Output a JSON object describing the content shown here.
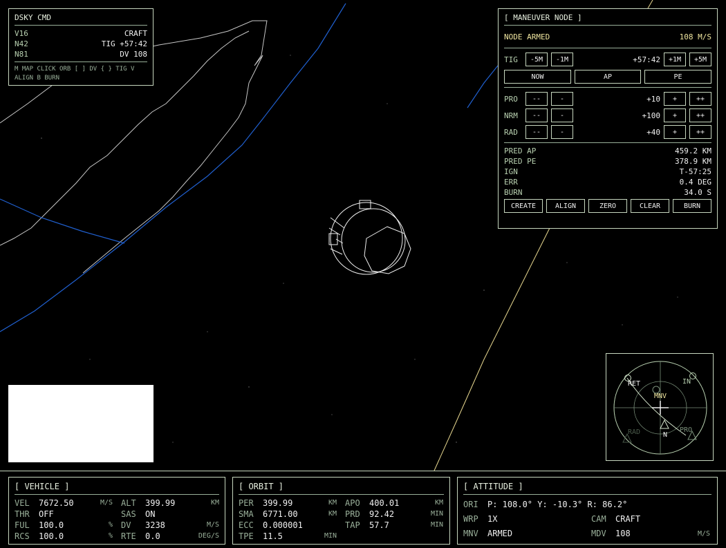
{
  "dsky": {
    "title": "DSKY CMD",
    "rows": [
      {
        "left": "V16",
        "right": "CRAFT"
      },
      {
        "left": "N42",
        "right": "TIG +57:42"
      },
      {
        "left": "N81",
        "right": "DV 108"
      }
    ],
    "help_line1": "M MAP CLICK ORB [ ] DV { } TIG V",
    "help_line2": "ALIGN B BURN"
  },
  "maneuver": {
    "title": "[ MANEUVER NODE ]",
    "status": "NODE ARMED",
    "dv": "108 M/S",
    "tig": {
      "label": "TIG",
      "value": "+57:42",
      "dec2": "-5M",
      "dec1": "-1M",
      "inc1": "+1M",
      "inc2": "+5M"
    },
    "presets": [
      "NOW",
      "AP",
      "PE"
    ],
    "axes": [
      {
        "label": "PRO",
        "value": "+10",
        "dec2": "--",
        "dec1": "-",
        "inc1": "+",
        "inc2": "++"
      },
      {
        "label": "NRM",
        "value": "+100",
        "dec2": "--",
        "dec1": "-",
        "inc1": "+",
        "inc2": "++"
      },
      {
        "label": "RAD",
        "value": "+40",
        "dec2": "--",
        "dec1": "-",
        "inc1": "+",
        "inc2": "++"
      }
    ],
    "stats": [
      {
        "label": "PRED AP",
        "value": "459.2 KM"
      },
      {
        "label": "PRED PE",
        "value": "378.9 KM"
      },
      {
        "label": "IGN",
        "value": "T-57:25"
      },
      {
        "label": "ERR",
        "value": "0.4 DEG"
      },
      {
        "label": "BURN",
        "value": "34.0 S"
      }
    ],
    "actions": [
      "CREATE",
      "ALIGN",
      "ZERO",
      "CLEAR",
      "BURN"
    ]
  },
  "navball": {
    "labels": {
      "retro": "RET",
      "in": "IN",
      "mnv": "MNV",
      "rad": "RAD",
      "pro": "PRO",
      "north": "N"
    }
  },
  "vehicle": {
    "title": "[ VEHICLE ]",
    "rows": [
      {
        "l1": "VEL",
        "v1": "7672.50",
        "u1": "M/S",
        "l2": "ALT",
        "v2": "399.99",
        "u2": "KM"
      },
      {
        "l1": "THR",
        "v1": "OFF",
        "u1": "",
        "l2": "SAS",
        "v2": "ON",
        "u2": ""
      },
      {
        "l1": "FUL",
        "v1": "100.0",
        "u1": "%",
        "l2": "DV",
        "v2": "3238",
        "u2": "M/S"
      },
      {
        "l1": "RCS",
        "v1": "100.0",
        "u1": "%",
        "l2": "RTE",
        "v2": "0.0",
        "u2": "DEG/S"
      }
    ]
  },
  "orbit": {
    "title": "[ ORBIT ]",
    "rows": [
      {
        "l1": "PER",
        "v1": "399.99",
        "u1": "KM",
        "l2": "APO",
        "v2": "400.01",
        "u2": "KM"
      },
      {
        "l1": "SMA",
        "v1": "6771.00",
        "u1": "KM",
        "l2": "PRD",
        "v2": "92.42",
        "u2": "MIN"
      },
      {
        "l1": "ECC",
        "v1": "0.000001",
        "u1": "",
        "l2": "TAP",
        "v2": "57.7",
        "u2": "MIN"
      },
      {
        "l1": "TPE",
        "v1": "11.5",
        "u1": "MIN",
        "l2": "",
        "v2": "",
        "u2": ""
      }
    ]
  },
  "attitude": {
    "title": "[ ATTITUDE ]",
    "ori_label": "ORI",
    "ori_value": "P: 108.0° Y: -10.3° R: 86.2°",
    "wrp_label": "WRP",
    "wrp_value": "1X",
    "cam_label": "CAM",
    "cam_value": "CRAFT",
    "mnv_label": "MNV",
    "mnv_value": "ARMED",
    "mdv_label": "MDV",
    "mdv_value": "108",
    "mdv_unit": "M/S"
  },
  "colors": {
    "orbit_line": "#2060d0",
    "trajectory": "#e8d890",
    "frame": "#c8d8c0"
  }
}
